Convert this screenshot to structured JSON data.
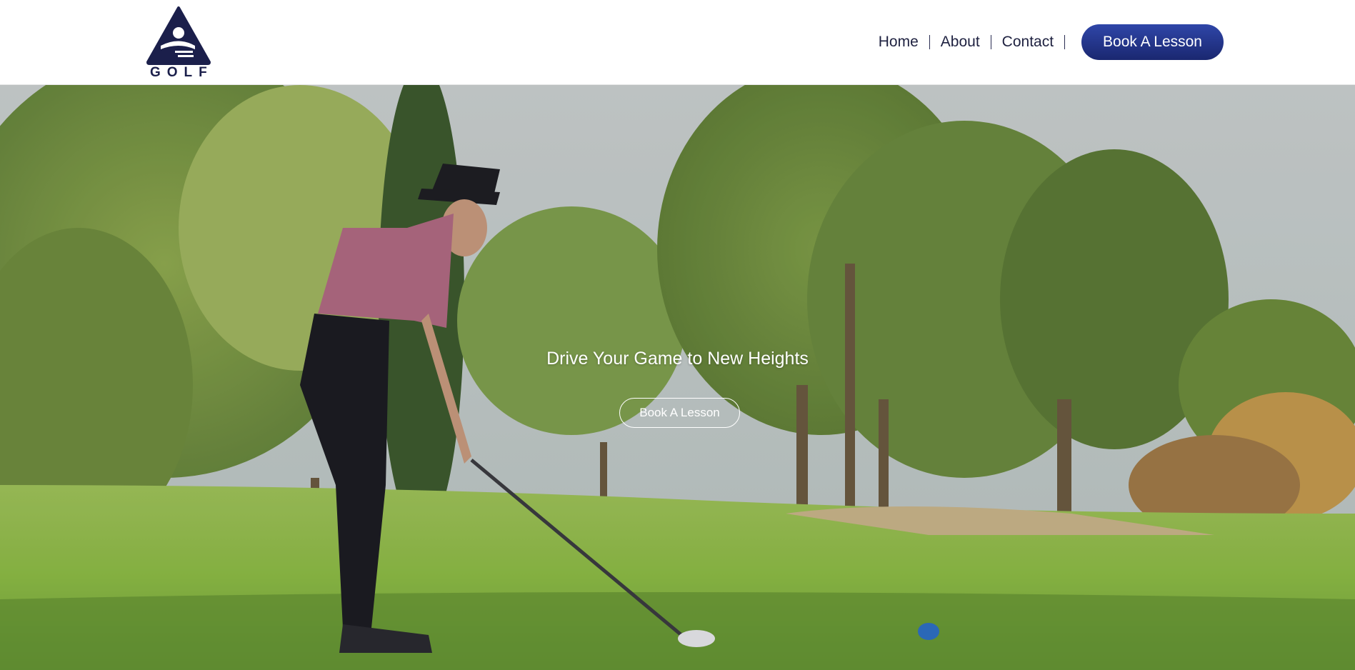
{
  "brand": {
    "logo_text": "GOLF",
    "color": "#1b1f4b"
  },
  "nav": {
    "items": [
      {
        "label": "Home"
      },
      {
        "label": "About"
      },
      {
        "label": "Contact"
      }
    ],
    "cta_label": "Book A Lesson",
    "cta_color": "#1f2f85"
  },
  "hero": {
    "headline": "Drive Your Game to New Heights",
    "cta_label": "Book A Lesson",
    "image": "golfer-teeing-off-on-course"
  }
}
